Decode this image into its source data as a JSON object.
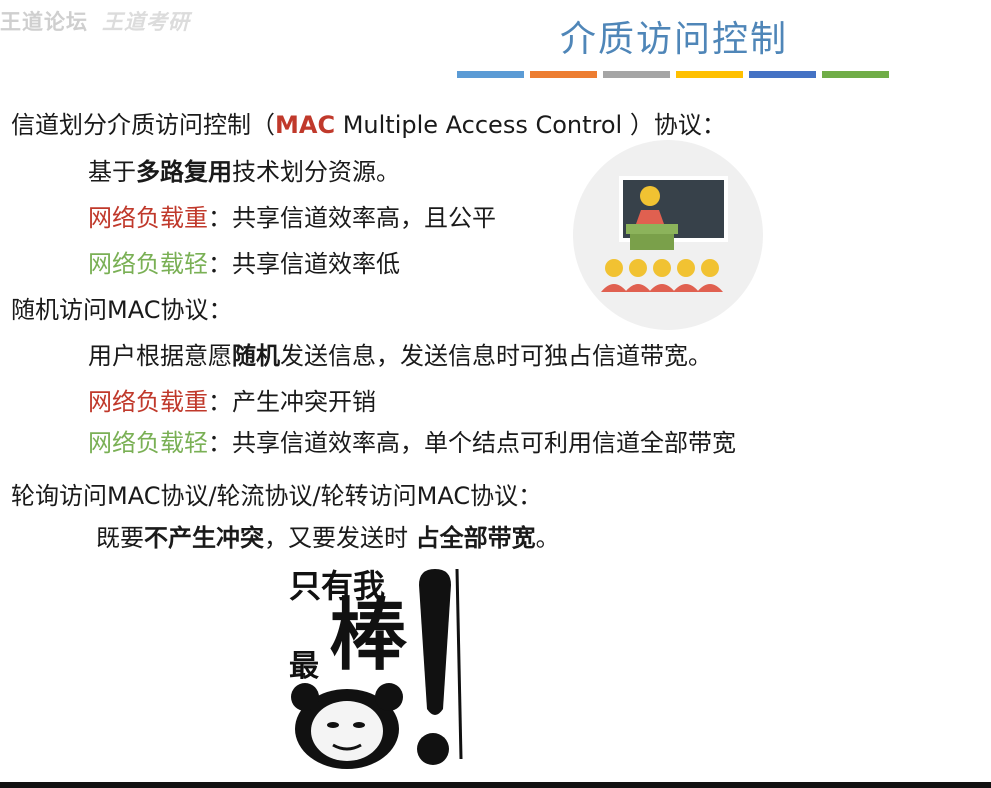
{
  "watermark": {
    "text": "王道论坛",
    "text2": "王道考研"
  },
  "header": {
    "title": "介质访问控制"
  },
  "accent_bars": [
    "#5b9bd5",
    "#ed7d31",
    "#a5a5a5",
    "#ffc000",
    "#4472c4",
    "#70ad47"
  ],
  "content": {
    "line1": {
      "prefix": "信道划分介质访问控制（",
      "mac": "MAC",
      "suffix": " Multiple Access Control ）协议："
    },
    "line2": {
      "a": "基于",
      "b": "多路复用",
      "c": "技术划分资源。"
    },
    "line3": {
      "label": "网络负载重",
      "text": "：共享信道效率高，且公平"
    },
    "line4": {
      "label": "网络负载轻",
      "text": "：共享信道效率低"
    },
    "line5": {
      "text": "随机访问MAC协议："
    },
    "line6": {
      "a": "用户根据意愿",
      "b": "随机",
      "c": "发送信息，发送信息时可独占信道带宽。"
    },
    "line7": {
      "label": "网络负载重",
      "text": "：产生冲突开销"
    },
    "line8": {
      "label": "网络负载轻",
      "text": "：共享信道效率高，单个结点可利用信道全部带宽"
    },
    "line9": {
      "text": "轮询访问MAC协议/轮流协议/轮转访问MAC协议："
    },
    "line10": {
      "a": "既要",
      "b": "不产生冲突",
      "c": "，又要发送时 ",
      "d": "占全部带宽",
      "e": "。"
    }
  },
  "meme": {
    "line1": "只有我",
    "line2": "最",
    "line3": "棒"
  },
  "colors": {
    "title": "#4f86b8",
    "red": "#c0392b",
    "green": "#7ab055"
  }
}
